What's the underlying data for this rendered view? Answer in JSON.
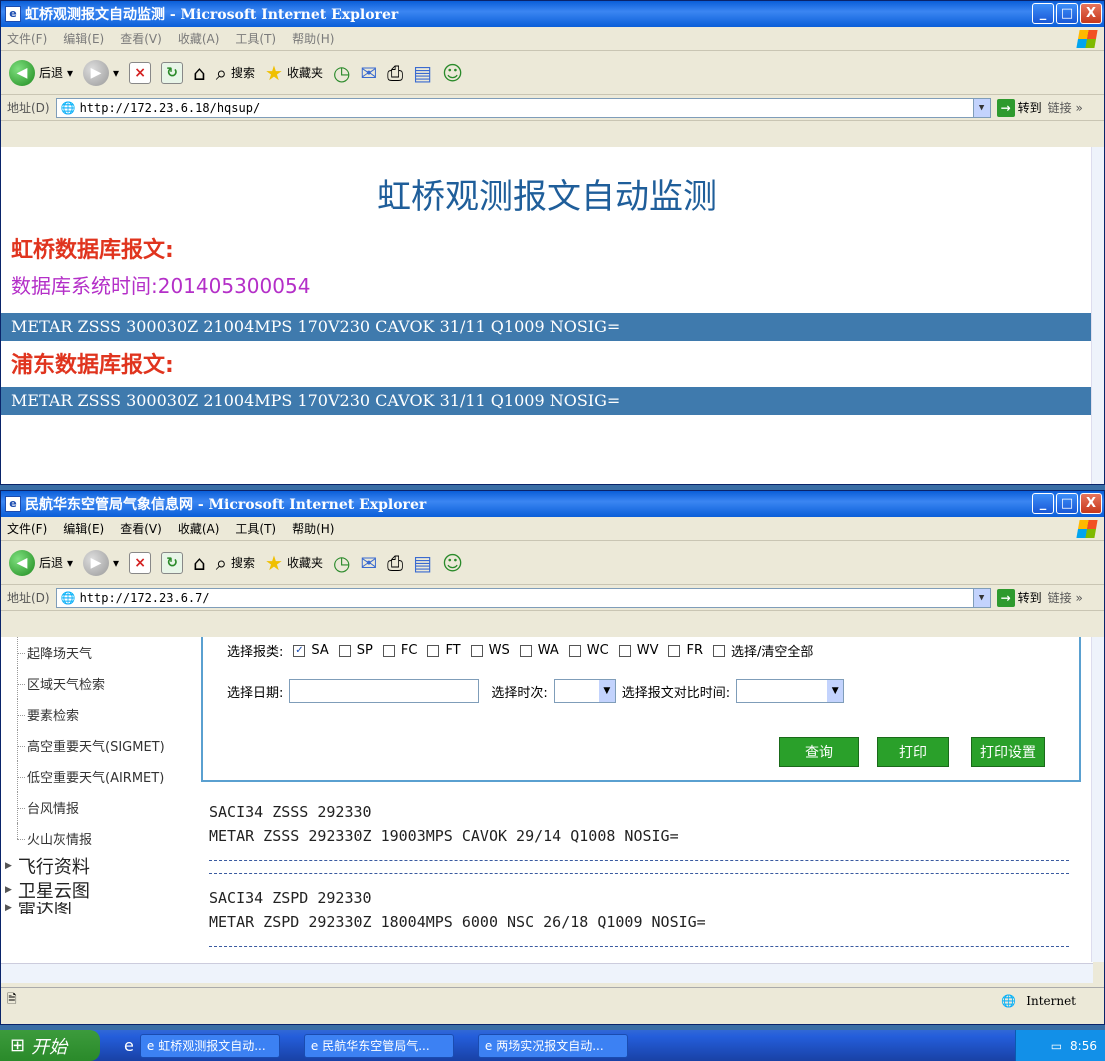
{
  "window1": {
    "title": "虹桥观测报文自动监测 - Microsoft Internet Explorer",
    "menu": [
      "文件(F)",
      "编辑(E)",
      "查看(V)",
      "收藏(A)",
      "工具(T)",
      "帮助(H)"
    ],
    "toolbar": {
      "back": "后退",
      "search": "搜索",
      "favorites": "收藏夹"
    },
    "address_label": "地址(D)",
    "url": "http://172.23.6.18/hqsup/",
    "go_label": "转到",
    "links_label": "链接",
    "page_title": "虹桥观测报文自动监测",
    "hq_label": "虹桥数据库报文:",
    "db_time_label": "数据库系统时间:201405300054",
    "hq_metar": "METAR ZSSS 300030Z 21004MPS 170V230 CAVOK 31/11 Q1009 NOSIG=",
    "pd_label": "浦东数据库报文:",
    "pd_metar": "METAR ZSSS 300030Z 21004MPS 170V230 CAVOK 31/11 Q1009 NOSIG="
  },
  "window2": {
    "title": "民航华东空管局气象信息网 - Microsoft Internet Explorer",
    "menu": [
      "文件(F)",
      "编辑(E)",
      "查看(V)",
      "收藏(A)",
      "工具(T)",
      "帮助(H)"
    ],
    "toolbar": {
      "back": "后退",
      "search": "搜索",
      "favorites": "收藏夹"
    },
    "address_label": "地址(D)",
    "url": "http://172.23.6.7/",
    "go_label": "转到",
    "links_label": "链接",
    "sidebar": {
      "items": [
        "起降场天气",
        "区域天气检索",
        "要素检索",
        "高空重要天气(SIGMET)",
        "低空重要天气(AIRMET)",
        "台风情报",
        "火山灰情报"
      ],
      "sections": [
        "飞行资料",
        "卫星云图",
        "雷达图"
      ]
    },
    "form": {
      "report_type_label": "选择报类:",
      "types": [
        {
          "label": "SA",
          "checked": true
        },
        {
          "label": "SP",
          "checked": false
        },
        {
          "label": "FC",
          "checked": false
        },
        {
          "label": "FT",
          "checked": false
        },
        {
          "label": "WS",
          "checked": false
        },
        {
          "label": "WA",
          "checked": false
        },
        {
          "label": "WC",
          "checked": false
        },
        {
          "label": "WV",
          "checked": false
        },
        {
          "label": "FR",
          "checked": false
        },
        {
          "label": "选择/清空全部",
          "checked": false
        }
      ],
      "date_label": "选择日期:",
      "time_label": "选择时次:",
      "compare_label": "选择报文对比时间:",
      "query_button": "查询",
      "print_button": "打印",
      "print_setup_button": "打印设置"
    },
    "reports": [
      {
        "header": "SACI34 ZSSS 292330",
        "body": "METAR ZSSS 292330Z 19003MPS CAVOK 29/14 Q1008 NOSIG="
      },
      {
        "header": "SACI34 ZSPD 292330",
        "body": "METAR ZSPD 292330Z 18004MPS 6000 NSC 26/18 Q1009 NOSIG="
      }
    ],
    "status_zone": "Internet"
  },
  "taskbar": {
    "start": "开始",
    "tasks": [
      "虹桥观测报文自动...",
      "民航华东空管局气...",
      "两场实况报文自动..."
    ],
    "clock": "8:56"
  }
}
